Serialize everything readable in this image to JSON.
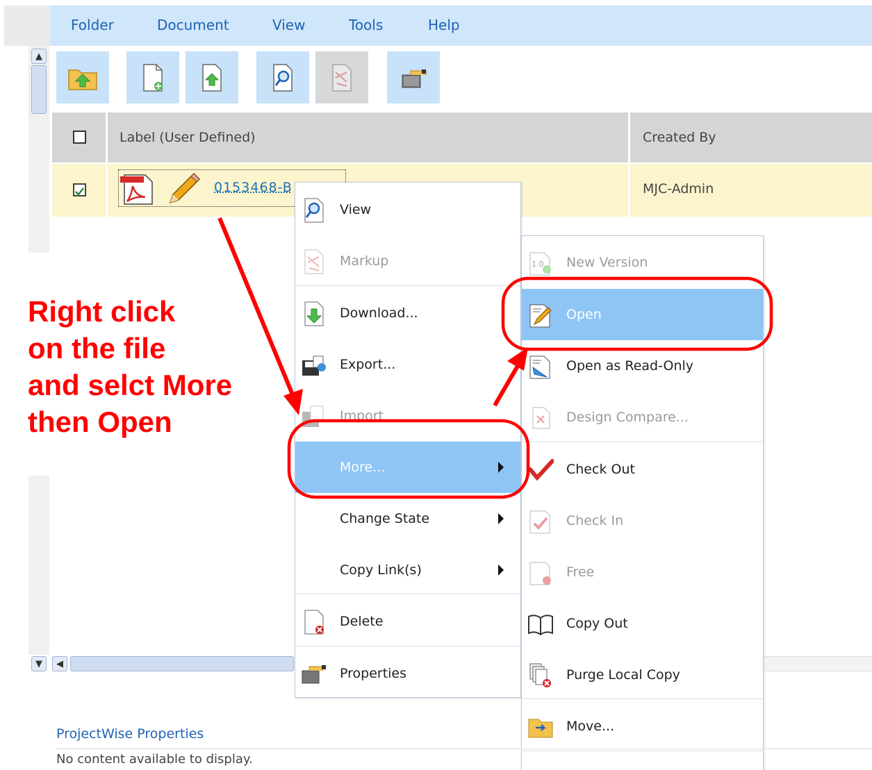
{
  "menubar": {
    "items": [
      "Folder",
      "Document",
      "View",
      "Tools",
      "Help"
    ]
  },
  "toolbar": {
    "buttons": [
      {
        "icon": "folder-up-icon"
      },
      {
        "icon": "new-document-icon"
      },
      {
        "icon": "upload-document-icon"
      },
      {
        "icon": "view-document-icon"
      },
      {
        "icon": "markup-icon",
        "disabled": true
      },
      {
        "icon": "properties-icon"
      }
    ]
  },
  "grid": {
    "columns": [
      "Label (User Defined)",
      "Created By"
    ],
    "rows": [
      {
        "label": "0153468-B",
        "created_by": "MJC-Admin",
        "checked": true
      }
    ]
  },
  "context_menu": {
    "items": [
      {
        "label": "View",
        "icon": "view-icon"
      },
      {
        "label": "Markup",
        "icon": "markup-icon",
        "disabled": true
      },
      {
        "label": "Download...",
        "icon": "download-icon"
      },
      {
        "label": "Export...",
        "icon": "export-icon"
      },
      {
        "label": "Import",
        "icon": "import-icon",
        "disabled": true
      },
      {
        "label": "More...",
        "highlighted": true,
        "submenu": true
      },
      {
        "label": "Change State",
        "submenu": true
      },
      {
        "label": "Copy Link(s)",
        "submenu": true
      },
      {
        "label": "Delete",
        "icon": "delete-icon"
      },
      {
        "label": "Properties",
        "icon": "properties-icon"
      }
    ]
  },
  "submenu": {
    "items": [
      {
        "label": "New Version",
        "icon": "new-version-icon",
        "disabled": true
      },
      {
        "label": "Open",
        "icon": "open-icon",
        "highlighted": true
      },
      {
        "label": "Open as Read-Only",
        "icon": "open-readonly-icon"
      },
      {
        "label": "Design Compare...",
        "icon": "design-compare-icon",
        "disabled": true
      },
      {
        "label": "Check Out",
        "icon": "check-out-icon"
      },
      {
        "label": "Check In",
        "icon": "check-in-icon",
        "disabled": true
      },
      {
        "label": "Free",
        "icon": "free-icon",
        "disabled": true
      },
      {
        "label": "Copy Out",
        "icon": "copy-out-icon"
      },
      {
        "label": "Purge Local Copy",
        "icon": "purge-icon"
      },
      {
        "label": "Move...",
        "icon": "move-icon"
      }
    ]
  },
  "annotation": {
    "lines": [
      "Right click",
      "on the file",
      "and selct More",
      "then Open"
    ],
    "color": "#ff0000"
  },
  "properties": {
    "title": "ProjectWise Properties",
    "empty_text": "No content available to display."
  },
  "colors": {
    "menubar_bg": "#cfe6fb",
    "link_blue": "#1f63b3",
    "highlight": "#8ec5f5",
    "selected_row": "#fcf4cd"
  }
}
